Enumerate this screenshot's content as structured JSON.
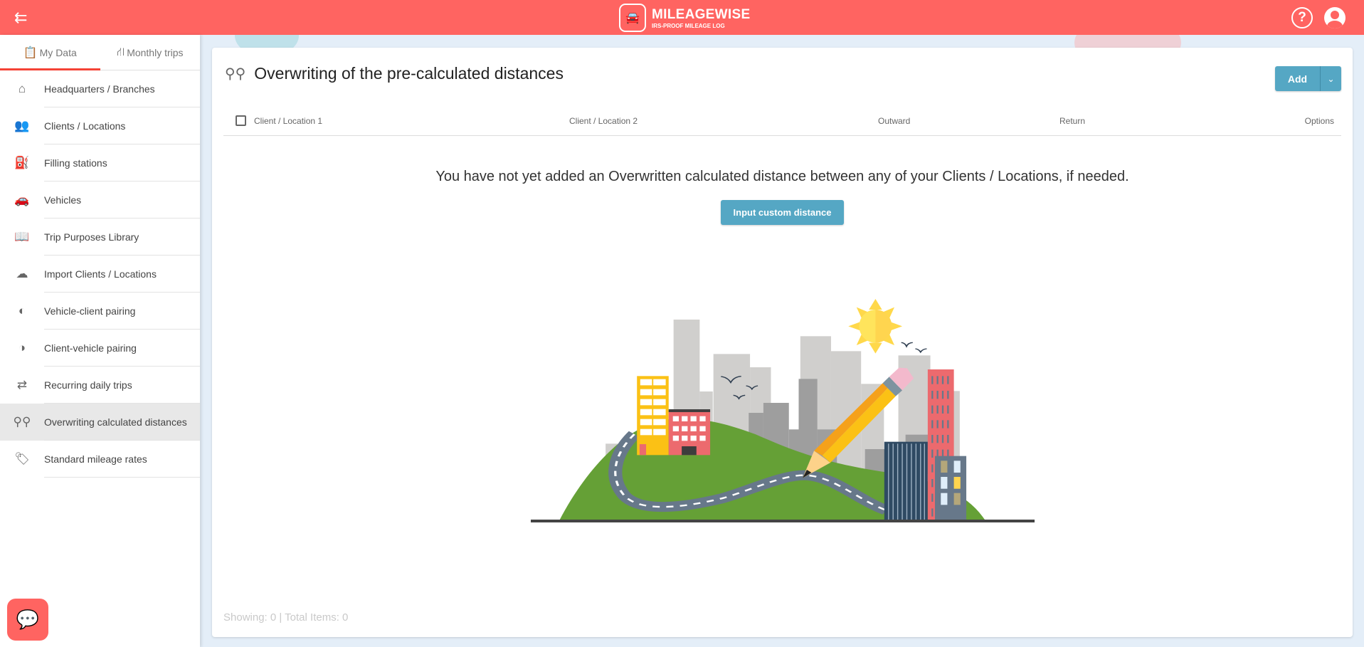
{
  "header": {
    "logo_title": "MILEAGEWISE",
    "logo_subtitle": "IRS-PROOF MILEAGE LOG",
    "help_label": "?"
  },
  "sidebar": {
    "tabs": [
      {
        "label": "My Data"
      },
      {
        "label": "Monthly trips"
      }
    ],
    "items": [
      {
        "label": "Headquarters / Branches"
      },
      {
        "label": "Clients / Locations"
      },
      {
        "label": "Filling stations"
      },
      {
        "label": "Vehicles"
      },
      {
        "label": "Trip Purposes Library"
      },
      {
        "label": "Import Clients / Locations"
      },
      {
        "label": "Vehicle-client pairing"
      },
      {
        "label": "Client-vehicle pairing"
      },
      {
        "label": "Recurring daily trips"
      },
      {
        "label": "Overwriting calculated distances"
      },
      {
        "label": "Standard mileage rates"
      }
    ]
  },
  "main": {
    "title": "Overwriting of the pre-calculated distances",
    "add_label": "Add",
    "columns": [
      "Client / Location 1",
      "Client / Location 2",
      "Outward",
      "Return",
      "Options"
    ],
    "empty_message": "You have not yet added an Overwritten calculated distance between any of your Clients / Locations, if needed.",
    "input_button": "Input custom distance",
    "footer": "Showing: 0 | Total Items: 0"
  },
  "colors": {
    "brand": "#ff6461",
    "accent": "#55a7c4"
  }
}
